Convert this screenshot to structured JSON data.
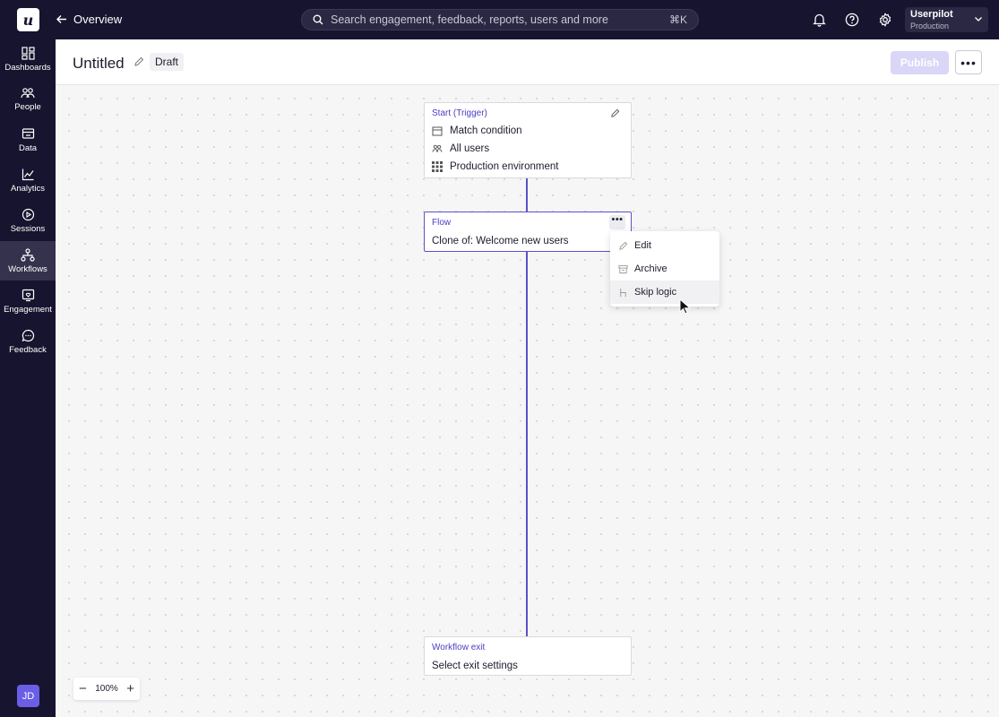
{
  "app": {
    "logo_letter": "u"
  },
  "topbar": {
    "back_label": "Overview",
    "search_placeholder": "Search engagement, feedback, reports, users and more",
    "search_shortcut": "⌘K",
    "icons": [
      "bell-icon",
      "help-icon",
      "gear-icon"
    ],
    "account": {
      "name": "Userpilot",
      "environment": "Production"
    }
  },
  "sidebar": {
    "items": [
      {
        "label": "Dashboards",
        "icon": "dashboard-icon"
      },
      {
        "label": "People",
        "icon": "people-icon"
      },
      {
        "label": "Data",
        "icon": "data-icon"
      },
      {
        "label": "Analytics",
        "icon": "analytics-icon"
      },
      {
        "label": "Sessions",
        "icon": "play-icon"
      },
      {
        "label": "Workflows",
        "icon": "workflow-icon",
        "active": true
      },
      {
        "label": "Engagement",
        "icon": "engagement-icon"
      },
      {
        "label": "Feedback",
        "icon": "chat-icon"
      }
    ],
    "user_initials": "JD"
  },
  "header": {
    "title": "Untitled",
    "status_badge": "Draft",
    "publish_label": "Publish",
    "more_label": "•••"
  },
  "canvas": {
    "trigger": {
      "heading": "Start (Trigger)",
      "rows": [
        "Match condition",
        "All users",
        "Production environment"
      ]
    },
    "flow": {
      "heading": "Flow",
      "name": "Clone of: Welcome new users",
      "menu_button": "•••"
    },
    "context_menu": {
      "items": [
        "Edit",
        "Archive",
        "Skip logic"
      ],
      "hovered": "Skip logic"
    },
    "exit": {
      "heading": "Workflow exit",
      "body": "Select exit settings"
    },
    "zoom": {
      "level": "100%",
      "minus": "−",
      "plus": "+"
    }
  },
  "colors": {
    "accent": "#5b52c9",
    "nav_bg": "#16142e",
    "publish_disabled": "#d9d6f7"
  }
}
